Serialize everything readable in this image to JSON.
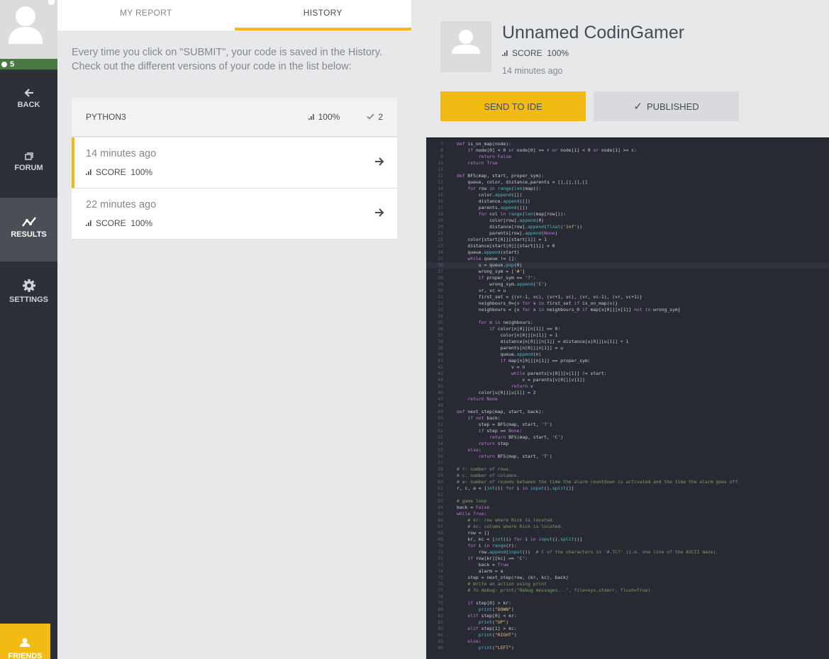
{
  "sidebar": {
    "level": "5",
    "items": [
      {
        "label": "BACK",
        "icon": "arrow-left-icon"
      },
      {
        "label": "FORUM",
        "icon": "forum-icon"
      },
      {
        "label": "RESULTS",
        "icon": "results-chart-icon",
        "active": true
      },
      {
        "label": "SETTINGS",
        "icon": "gear-icon"
      }
    ],
    "friends_label": "FRIENDS"
  },
  "tabs": [
    {
      "label": "MY REPORT",
      "active": false
    },
    {
      "label": "HISTORY",
      "active": true
    }
  ],
  "intro_text": "Every time you click on \"SUBMIT\", your code is saved in the History. Check out the different versions of your code in the list below:",
  "language_row": {
    "language": "PYTHON3",
    "score": "100%",
    "count": "2"
  },
  "history": [
    {
      "time": "14 minutes ago",
      "score_label": "SCORE",
      "score": "100%",
      "selected": true
    },
    {
      "time": "22 minutes ago",
      "score_label": "SCORE",
      "score": "100%",
      "selected": false
    }
  ],
  "player": {
    "name": "Unnamed CodinGamer",
    "score_label": "SCORE",
    "score": "100%",
    "time": "14 minutes ago"
  },
  "buttons": {
    "send_to_ide": "SEND TO IDE",
    "published": "PUBLISHED"
  },
  "colors": {
    "accent": "#f2bb13",
    "sidebar": "#2d3036",
    "level_green": "#4a7a43",
    "code_bg": "#272a33"
  },
  "code": {
    "current_line": 26,
    "lines": [
      {
        "n": 7,
        "t": "def is_on_map(node):"
      },
      {
        "n": 8,
        "t": "    if node[0] < 0 or node[0] >= r or node[1] < 0 or node[1] >= c:"
      },
      {
        "n": 9,
        "t": "        return False"
      },
      {
        "n": 10,
        "t": "    return True"
      },
      {
        "n": 11,
        "t": ""
      },
      {
        "n": 12,
        "t": "def BFS(map, start, proper_sym):"
      },
      {
        "n": 13,
        "t": "    queue, color, distance,parents = [],[],[],[]"
      },
      {
        "n": 14,
        "t": "    for row in range(len(map)):"
      },
      {
        "n": 15,
        "t": "        color.append([])"
      },
      {
        "n": 16,
        "t": "        distance.append([])"
      },
      {
        "n": 17,
        "t": "        parents.append([])"
      },
      {
        "n": 18,
        "t": "        for col in range(len(map[row])):"
      },
      {
        "n": 19,
        "t": "            color[row].append(0)"
      },
      {
        "n": 20,
        "t": "            distance[row].append(float('inf'))"
      },
      {
        "n": 21,
        "t": "            parents[row].append(None)"
      },
      {
        "n": 22,
        "t": "    color[start[0]][start[1]] = 1"
      },
      {
        "n": 23,
        "t": "    distance[start[0]][start[1]] = 0"
      },
      {
        "n": 24,
        "t": "    queue.append(start)"
      },
      {
        "n": 25,
        "t": "    while queue != []:"
      },
      {
        "n": 26,
        "t": "        u = queue.pop(0)"
      },
      {
        "n": 27,
        "t": "        wrong_sym = ['#']"
      },
      {
        "n": 28,
        "t": "        if proper_sym == '?':"
      },
      {
        "n": 29,
        "t": "            wrong_sym.append('C')"
      },
      {
        "n": 30,
        "t": "        vr, vc = u"
      },
      {
        "n": 31,
        "t": "        first_set = {(vr-1, vc), (vr+1, vc), (vr, vc-1), (vr, vc+1)}"
      },
      {
        "n": 32,
        "t": "        neighbours_0={v for v in first_set if is_on_map(v)}"
      },
      {
        "n": 33,
        "t": "        neighbours = {x for x in neighbours_0 if map[x[0]][x[1]] not in wrong_sym}"
      },
      {
        "n": 34,
        "t": ""
      },
      {
        "n": 35,
        "t": "        for n in neighbours:"
      },
      {
        "n": 36,
        "t": "            if color[n[0]][n[1]] == 0:"
      },
      {
        "n": 37,
        "t": "                color[n[0]][n[1]] = 1"
      },
      {
        "n": 38,
        "t": "                distance[n[0]][n[1]] = distance[u[0]][u[1]] + 1"
      },
      {
        "n": 39,
        "t": "                parents[n[0]][n[1]] = u"
      },
      {
        "n": 40,
        "t": "                queue.append(n)"
      },
      {
        "n": 41,
        "t": "                if map[n[0]][n[1]] == proper_sym:"
      },
      {
        "n": 42,
        "t": "                    v = n"
      },
      {
        "n": 43,
        "t": "                    while parents[v[0]][v[1]] != start:"
      },
      {
        "n": 44,
        "t": "                        v = parents[v[0]][v[1]]"
      },
      {
        "n": 45,
        "t": "                    return v"
      },
      {
        "n": 46,
        "t": "        color[u[0]][u[1]] = 2"
      },
      {
        "n": 47,
        "t": "    return None"
      },
      {
        "n": 48,
        "t": ""
      },
      {
        "n": 49,
        "t": "def next_step(map, start, back):"
      },
      {
        "n": 50,
        "t": "    if not back:"
      },
      {
        "n": 51,
        "t": "        step = BFS(map, start, '?')"
      },
      {
        "n": 52,
        "t": "        if step == None:"
      },
      {
        "n": 53,
        "t": "            return BFS(map, start, 'C')"
      },
      {
        "n": 54,
        "t": "        return step"
      },
      {
        "n": 55,
        "t": "    else:"
      },
      {
        "n": 56,
        "t": "        return BFS(map, start, 'T')"
      },
      {
        "n": 57,
        "t": ""
      },
      {
        "n": 58,
        "t": "# r: number of rows."
      },
      {
        "n": 59,
        "t": "# c: number of columns."
      },
      {
        "n": 60,
        "t": "# a: number of rounds between the time the alarm countdown is activated and the time the alarm goes off."
      },
      {
        "n": 61,
        "t": "r, c, a = [int(i) for i in input().split()]"
      },
      {
        "n": 62,
        "t": ""
      },
      {
        "n": 63,
        "t": "# game loop"
      },
      {
        "n": 64,
        "t": "back = False"
      },
      {
        "n": 65,
        "t": "while True:"
      },
      {
        "n": 66,
        "t": "    # kr: row where Rick is located."
      },
      {
        "n": 67,
        "t": "    # kc: column where Rick is located."
      },
      {
        "n": 68,
        "t": "    row = []"
      },
      {
        "n": 69,
        "t": "    kr, kc = [int(i) for i in input().split()]"
      },
      {
        "n": 70,
        "t": "    for i in range(r):"
      },
      {
        "n": 71,
        "t": "        row.append(input())  # C of the characters in '#.TC?' (i.e. one line of the ASCII maze)."
      },
      {
        "n": 72,
        "t": "    if row[kr][kc] == 'C':"
      },
      {
        "n": 73,
        "t": "        back = True"
      },
      {
        "n": 74,
        "t": "        alarm = a"
      },
      {
        "n": 75,
        "t": "    step = next_step(row, (kr, kc), back)"
      },
      {
        "n": 76,
        "t": "    # Write an action using print"
      },
      {
        "n": 77,
        "t": "    # To debug: print(\"Debug messages...\", file=sys.stderr, flush=True)"
      },
      {
        "n": 78,
        "t": ""
      },
      {
        "n": 79,
        "t": "    if step[0] > kr:"
      },
      {
        "n": 80,
        "t": "        print(\"DOWN\")"
      },
      {
        "n": 81,
        "t": "    elif step[0] < kr:"
      },
      {
        "n": 82,
        "t": "        print(\"UP\")"
      },
      {
        "n": 83,
        "t": "    elif step[1] > kc:"
      },
      {
        "n": 84,
        "t": "        print(\"RIGHT\")"
      },
      {
        "n": 85,
        "t": "    else:"
      },
      {
        "n": 86,
        "t": "        print(\"LEFT\")"
      }
    ]
  }
}
